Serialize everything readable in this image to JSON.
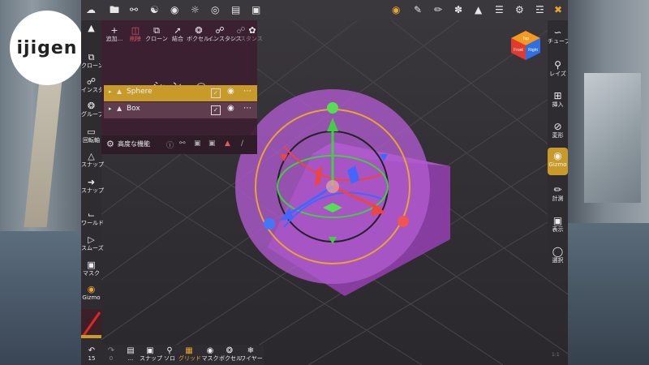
{
  "brand": {
    "logo_text": "ijigen"
  },
  "topbar": {
    "icons": [
      "home-icon",
      "folder-icon",
      "hierarchy-icon",
      "share-icon",
      "globe-icon",
      "sun-icon",
      "render-icon",
      "image-icon",
      "video-icon",
      "gizmo-icon",
      "pen-icon",
      "brush-icon",
      "sculpt-icon",
      "shape-icon",
      "layers-icon",
      "gear-icon",
      "sliders-icon",
      "tools-icon"
    ]
  },
  "left_toolbar": {
    "items": [
      {
        "id": "move",
        "label": "",
        "icon": "move-icon"
      },
      {
        "id": "clone",
        "label": "クローン",
        "icon": "clone-icon"
      },
      {
        "id": "instance",
        "label": "インスタンス",
        "icon": "link-icon"
      },
      {
        "id": "group",
        "label": "グループ",
        "icon": "group-icon"
      },
      {
        "id": "pivot",
        "label": "回転軸",
        "icon": "lock-icon"
      },
      {
        "id": "snap1",
        "label": "スナップ",
        "icon": "snap-triangle-icon"
      },
      {
        "id": "snap2",
        "label": "スナップ",
        "icon": "snap-arrow-icon"
      },
      {
        "id": "world",
        "label": "ワールド",
        "icon": "world-axis-icon"
      },
      {
        "id": "smooth",
        "label": "スムーズ",
        "icon": "play-box-icon"
      },
      {
        "id": "mask",
        "label": "マスク",
        "icon": "mask-icon"
      },
      {
        "id": "gizmo",
        "label": "Gizmo",
        "icon": "gizmo-icon"
      }
    ]
  },
  "right_toolbar": {
    "items": [
      {
        "id": "tube",
        "label": "チューブ",
        "icon": "tube-icon"
      },
      {
        "id": "layers",
        "label": "レイズ",
        "icon": "vase-icon"
      },
      {
        "id": "insert",
        "label": "挿入",
        "icon": "insert-icon"
      },
      {
        "id": "deform",
        "label": "変形",
        "icon": "deform-icon"
      },
      {
        "id": "gizmo",
        "label": "Gizmo",
        "icon": "gizmo-icon",
        "active": true
      },
      {
        "id": "measure",
        "label": "計測",
        "icon": "ruler-icon"
      },
      {
        "id": "view",
        "label": "表示",
        "icon": "camera-icon"
      },
      {
        "id": "select",
        "label": "選択",
        "icon": "lasso-icon"
      }
    ]
  },
  "bottom_toolbar": {
    "items": [
      {
        "id": "undo",
        "label": "15",
        "icon": "undo-icon"
      },
      {
        "id": "redo",
        "label": "0",
        "icon": "redo-icon"
      },
      {
        "id": "save",
        "label": "...",
        "icon": "save-icon"
      },
      {
        "id": "snap",
        "label": "スナップ",
        "icon": "snap-camera-icon"
      },
      {
        "id": "solo",
        "label": "ソロ",
        "icon": "search-icon"
      },
      {
        "id": "grid",
        "label": "グリッド",
        "icon": "grid-icon"
      },
      {
        "id": "mask",
        "label": "マスク",
        "icon": "mask-eye-icon"
      },
      {
        "id": "voxel",
        "label": "ボクセル",
        "icon": "voxel-icon"
      },
      {
        "id": "wire",
        "label": "ワイヤー",
        "icon": "wire-icon"
      }
    ]
  },
  "scene_panel": {
    "tools": [
      {
        "id": "add",
        "label": "追加...",
        "icon": "plus-icon"
      },
      {
        "id": "delete",
        "label": "削除",
        "icon": "trash-icon"
      },
      {
        "id": "clone",
        "label": "クローン",
        "icon": "clone-icon"
      },
      {
        "id": "merge",
        "label": "結合",
        "icon": "merge-icon"
      },
      {
        "id": "voxel",
        "label": "ボクセル...",
        "icon": "voxel-icon"
      },
      {
        "id": "instance",
        "label": "インスタンス",
        "icon": "link-icon"
      },
      {
        "id": "instance_dim",
        "label": "インスタンス",
        "icon": "unlink-icon"
      },
      {
        "id": "pin",
        "label": "",
        "icon": "pin-icon"
      }
    ],
    "title": "シーン",
    "objects": [
      {
        "name": "Sphere",
        "selected": true,
        "visible": true,
        "checked": true
      },
      {
        "name": "Box",
        "selected": false,
        "visible": true,
        "checked": true
      }
    ],
    "advanced_label": "高度な機能"
  },
  "nav_cube": {
    "faces": [
      {
        "label": "Top",
        "color": "#f39a1e"
      },
      {
        "label": "Front",
        "color": "#e23a2f"
      },
      {
        "label": "Right",
        "color": "#2f6fe3"
      }
    ]
  },
  "status": {
    "corner_text": "1:1"
  },
  "colors": {
    "accent": "#c79a2a",
    "object": "#a64dc0",
    "axis_x": "#e44",
    "axis_y": "#4c4",
    "axis_z": "#46f"
  }
}
